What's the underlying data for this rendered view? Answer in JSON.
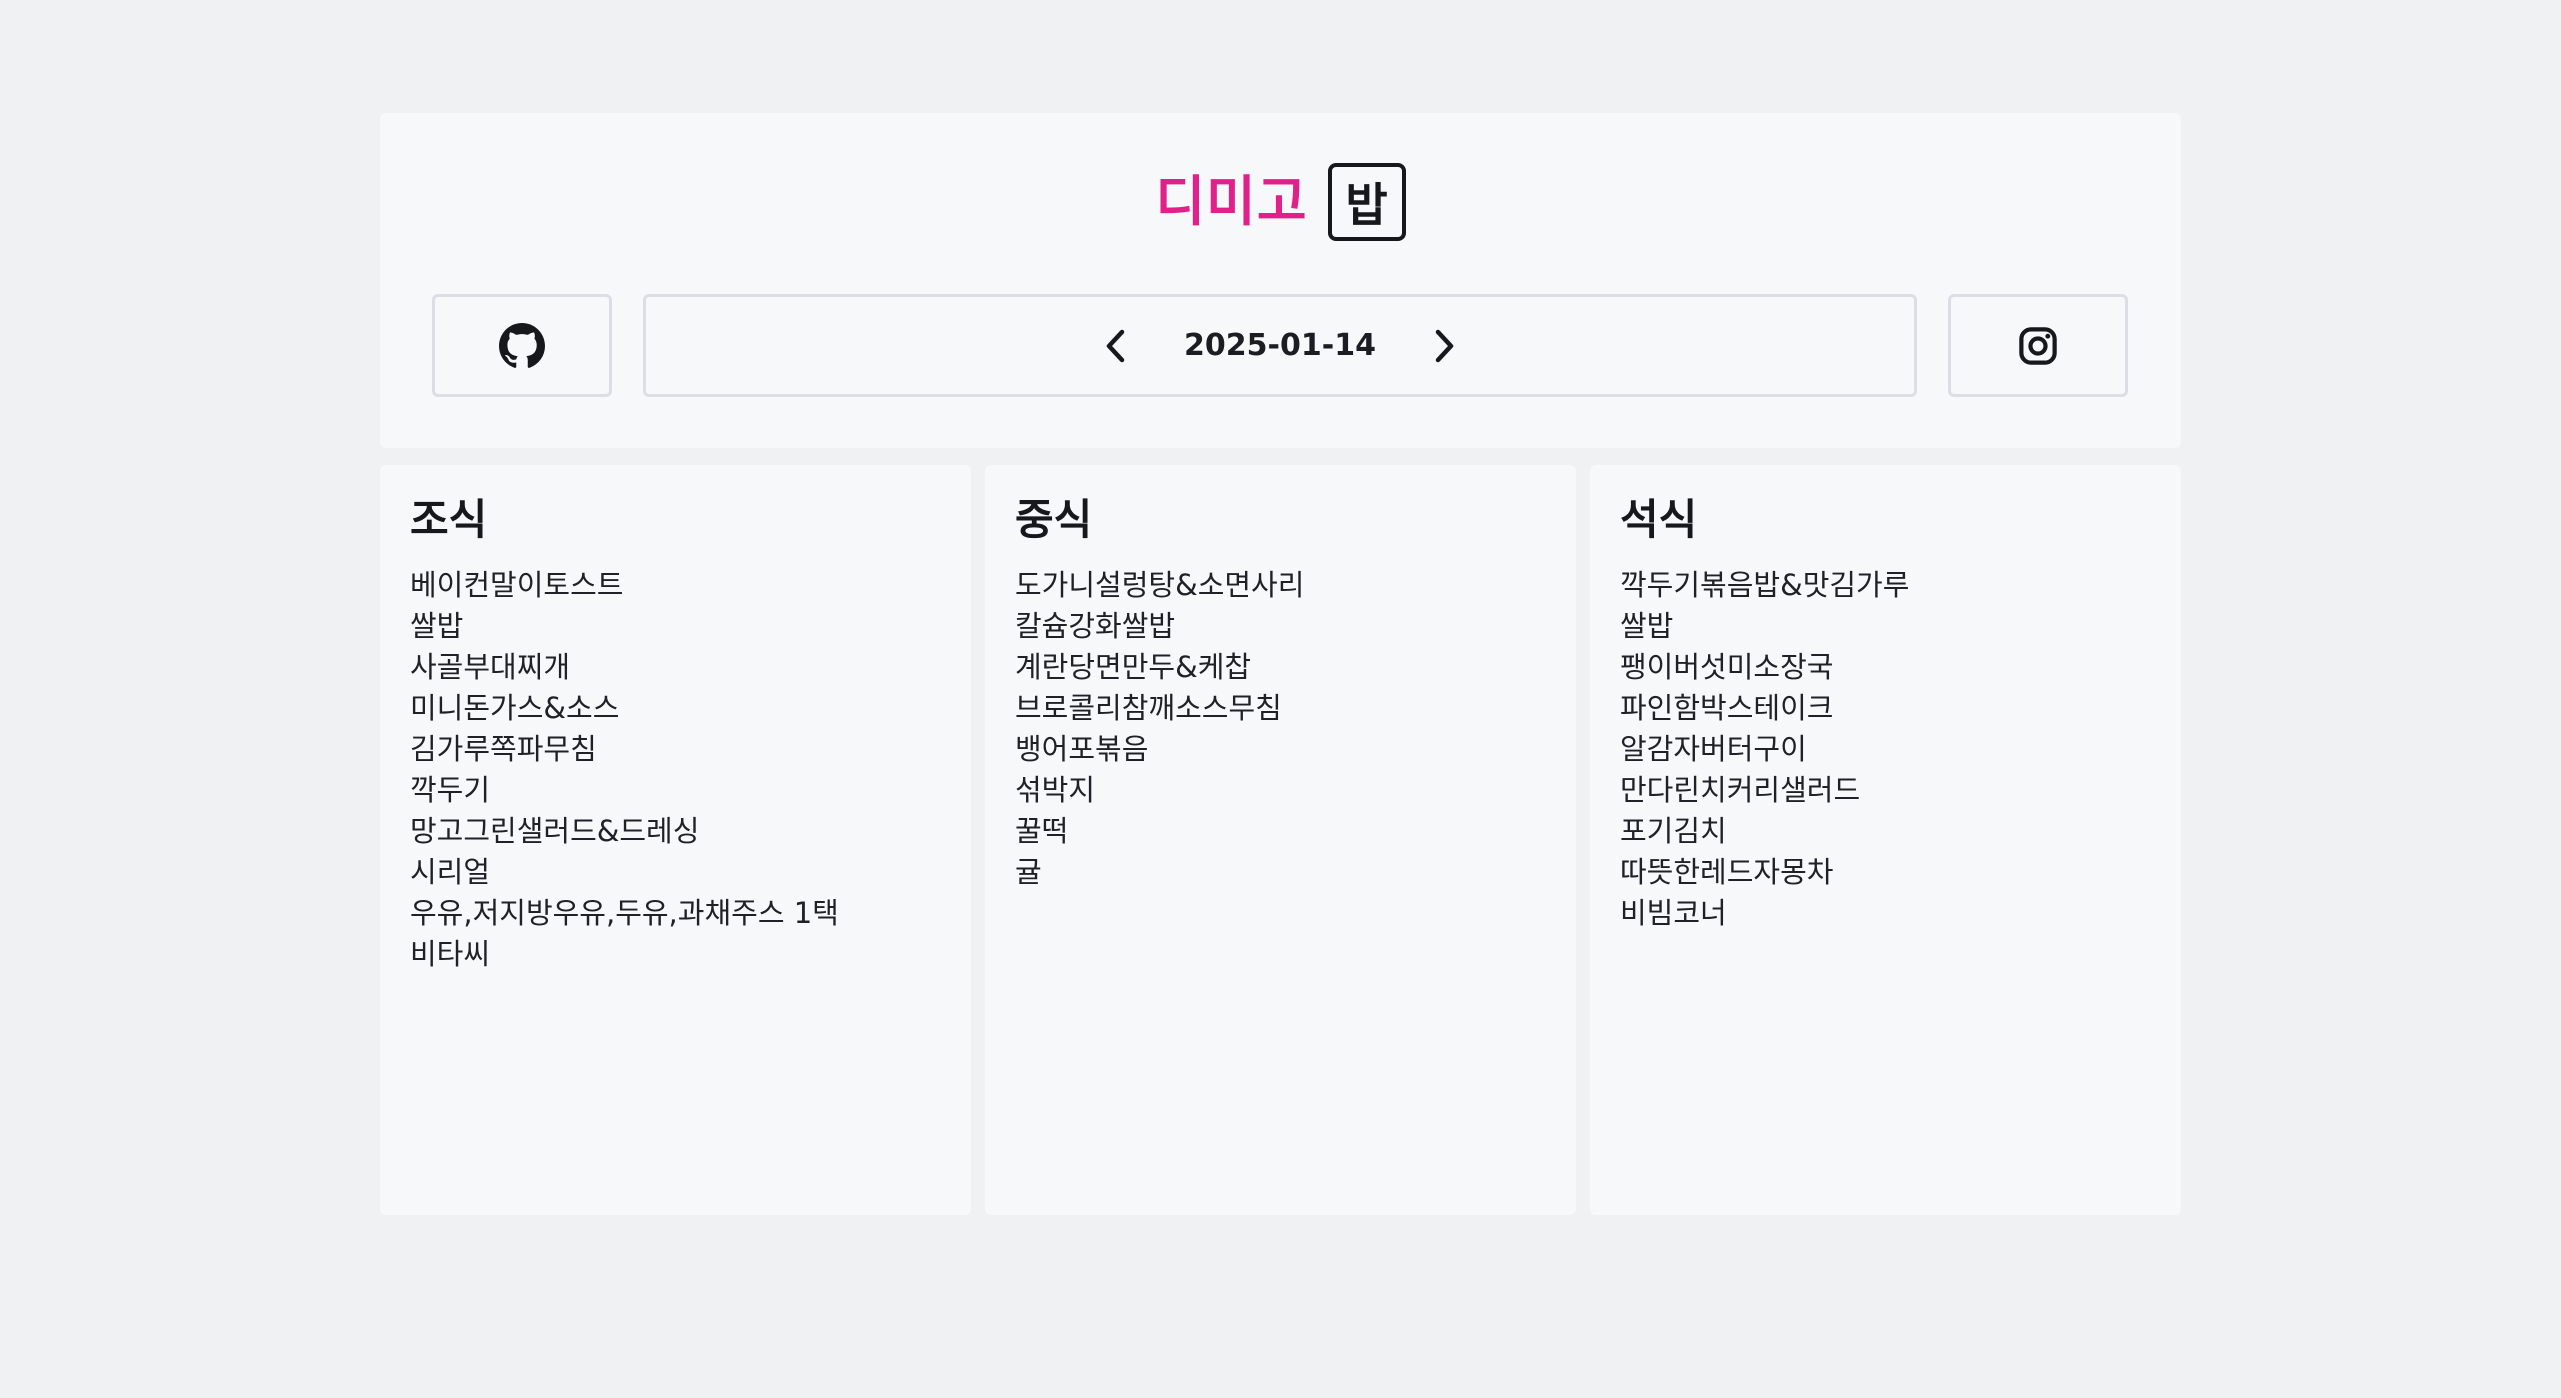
{
  "header": {
    "logo_text": "디미고",
    "logo_box_text": "밥"
  },
  "nav": {
    "date": "2025-01-14",
    "github_icon": "github-icon",
    "instagram_icon": "instagram-icon",
    "prev_icon": "chevron-left-icon",
    "next_icon": "chevron-right-icon"
  },
  "meals": {
    "breakfast": {
      "title": "조식",
      "items": [
        "베이컨말이토스트",
        "쌀밥",
        "사골부대찌개",
        "미니돈가스&소스",
        "김가루쪽파무침",
        "깍두기",
        "망고그린샐러드&드레싱",
        "시리얼",
        "우유,저지방우유,두유,과채주스 1택",
        "비타씨"
      ]
    },
    "lunch": {
      "title": "중식",
      "items": [
        "도가니설렁탕&소면사리",
        "칼슘강화쌀밥",
        "계란당면만두&케찹",
        "브로콜리참깨소스무침",
        "뱅어포볶음",
        "섞박지",
        "꿀떡",
        "귤"
      ]
    },
    "dinner": {
      "title": "석식",
      "items": [
        "깍두기볶음밥&맛김가루",
        "쌀밥",
        "팽이버섯미소장국",
        "파인함박스테이크",
        "알감자버터구이",
        "만다린치커리샐러드",
        "포기김치",
        "따뜻한레드자몽차",
        "비빔코너"
      ]
    }
  },
  "colors": {
    "brand": "#e0218a",
    "background": "#f0f1f3",
    "card": "#f7f8fa"
  }
}
